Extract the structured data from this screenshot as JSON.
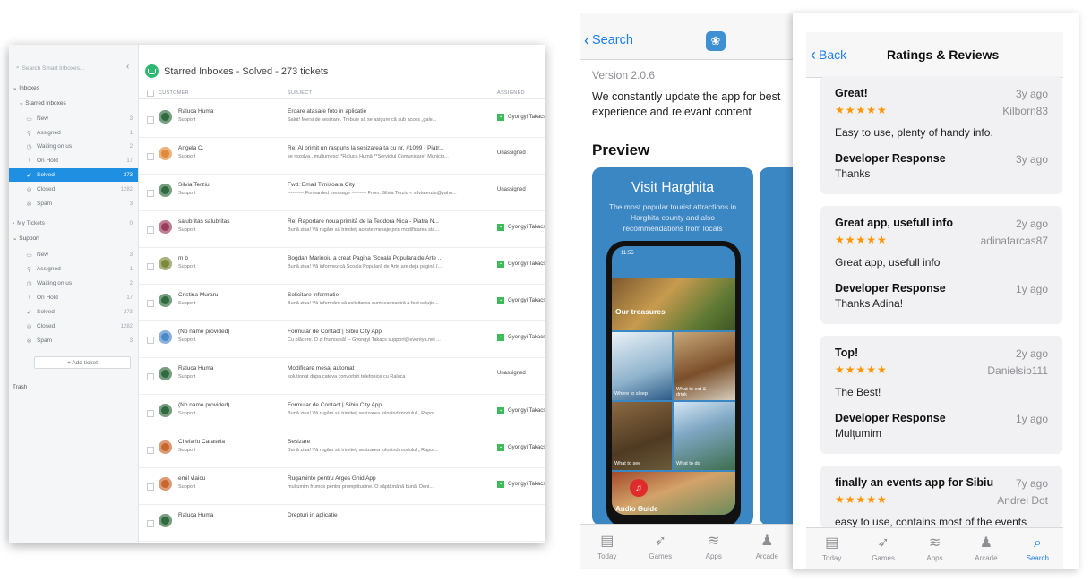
{
  "helpdesk": {
    "search_placeholder": "Search Smart Inboxes...",
    "title": "Starred Inboxes - Solved - 273 tickets",
    "sidebar": {
      "inboxes_label": "Inboxes",
      "starred_label": "Starred inboxes",
      "starred_items": [
        {
          "label": "New",
          "count": "3"
        },
        {
          "label": "Assigned",
          "count": "1"
        },
        {
          "label": "Waiting on us",
          "count": "2"
        },
        {
          "label": "On Hold",
          "count": "17"
        },
        {
          "label": "Solved",
          "count": "273"
        },
        {
          "label": "Closed",
          "count": "1282"
        },
        {
          "label": "Spam",
          "count": "3"
        }
      ],
      "my_tickets_label": "My Tickets",
      "my_tickets_count": "0",
      "support_label": "Support",
      "support_items": [
        {
          "label": "New",
          "count": "3"
        },
        {
          "label": "Assigned",
          "count": "1"
        },
        {
          "label": "Waiting on us",
          "count": "2"
        },
        {
          "label": "On Hold",
          "count": "17"
        },
        {
          "label": "Solved",
          "count": "273"
        },
        {
          "label": "Closed",
          "count": "1282"
        },
        {
          "label": "Spam",
          "count": "3"
        }
      ],
      "add_ticket_label": "+ Add ticket",
      "trash_label": "Trash"
    },
    "columns": {
      "customer": "CUSTOMER",
      "subject": "SUBJECT",
      "assigned": "ASSIGNED"
    },
    "tickets": [
      {
        "customer": "Raluca Huma",
        "inbox": "Support",
        "subject": "Eroare atasare foto in aplicatie",
        "preview": "Salut! Mersi de sesizare. Trebuie să se asigure că sub acces „gale...",
        "assigned": "Gyongyi Takacs",
        "avatar_color": "#2f6b3e"
      },
      {
        "customer": "Angela C.",
        "inbox": "Support",
        "subject": "Re: Al primit un raspuns la sesizarea ta cu nr. #1099 - Piatr...",
        "preview": "se rezolva.. multumesc! *Raluca Humă **Serviciul Comunicare* Municip...",
        "assigned": "Unassigned",
        "avatar_color": "#e08a3c"
      },
      {
        "customer": "Silvia Terziu",
        "inbox": "Support",
        "subject": "Fwd: Email Timisoara City",
        "preview": "---------- Forwarded message --------- From: Silvia Terziu < silviaterziu@yaho...",
        "assigned": "Unassigned",
        "avatar_color": "#2f6b3e"
      },
      {
        "customer": "salubritas salubritas",
        "inbox": "Support",
        "subject": "Re: Raportare noua primită de la Teodora Nica - Piatra N...",
        "preview": "Bună ziua! Vă rugăm să trimiteți aceste mesaje prin modificarea sta...",
        "assigned": "Gyongyi Takacs",
        "avatar_color": "#9a3b5a"
      },
      {
        "customer": "m b",
        "inbox": "Support",
        "subject": "Bogdan Marinoiu a creat Pagina 'Scoala Populara de Arte ...",
        "preview": "Bună ziua! Vă informez că Școala Populară de Arte are deja pagină î...",
        "assigned": "Gyongyi Takacs",
        "avatar_color": "#7a8a3a"
      },
      {
        "customer": "Cristina Muraru",
        "inbox": "Support",
        "subject": "Solicitare informatie",
        "preview": "Bună ziua! Vă informăm că solicitarea dumneavoastră a fost soluțio...",
        "assigned": "Gyongyi Takacs",
        "avatar_color": "#2f6b3e"
      },
      {
        "customer": "(No name provided)",
        "inbox": "Support",
        "subject": "Formular de Contact | Sibiu City App",
        "preview": "Cu plăcere. O zi frumoasă! -- Gyongyi Takacs support@eventya.net ...",
        "assigned": "Gyongyi Takacs",
        "avatar_color": "#4a88c8"
      },
      {
        "customer": "Raluca Huma",
        "inbox": "Support",
        "subject": "Modificare mesaj automat",
        "preview": "solutionat dupa cateva convorbiri telefonice cu Raluca",
        "assigned": "Unassigned",
        "avatar_color": "#2f6b3e"
      },
      {
        "customer": "(No name provided)",
        "inbox": "Support",
        "subject": "Formular de Contact | Sibiu City App",
        "preview": "Bună ziua! Vă rugăm să trimiteți sesizarea folosind modulul „ Rapor...",
        "assigned": "Gyongyi Takacs",
        "avatar_color": "#2f6b3e"
      },
      {
        "customer": "Chelariu Carasela",
        "inbox": "Support",
        "subject": "Sesizare",
        "preview": "Bună ziua! Vă rugăm să trimiteți sesizarea folosind modulul „ Rapor...",
        "assigned": "Gyongyi Takacs",
        "avatar_color": "#c8662e"
      },
      {
        "customer": "emil vlaicu",
        "inbox": "Support",
        "subject": "Rugaminte pentru Arges Ghid App",
        "preview": "mulțumim frumos pentru promptitudine. O săptămână bună, Deni...",
        "assigned": "Gyongyi Takacs",
        "avatar_color": "#c8662e"
      },
      {
        "customer": "Raluca Huma",
        "inbox": "",
        "subject": "Drepturi in aplicatie",
        "preview": "",
        "assigned": "",
        "avatar_color": "#2f6b3e"
      }
    ],
    "accent_color": "#1e8fe1",
    "assign_badge_color": "#3dbb5b"
  },
  "appstore_left": {
    "back_label": "Search",
    "version": "Version 2.0.6",
    "description": "We  constantly update the app for best experience and relevant content",
    "preview_heading": "Preview",
    "screenshot": {
      "title": "Visit Harghita",
      "subtitle": "The most popular tourist attractions in Harghita county and also recommendations from locals",
      "status_time": "11:55",
      "section_label": "Our treasures",
      "tiles": [
        "Where to sleep",
        "What to eat & drink",
        "What to see",
        "What to do",
        "Audio Guide"
      ]
    },
    "tabs": [
      "Today",
      "Games",
      "Apps",
      "Arcade"
    ]
  },
  "appstore_right": {
    "back_label": "Back",
    "title": "Ratings & Reviews",
    "reviews": [
      {
        "title": "Great!",
        "date": "3y ago",
        "stars": "★★★★★",
        "author": "Kilborn83",
        "body": "Easy to use, plenty of handy info.",
        "response_label": "Developer Response",
        "response_date": "3y ago",
        "response": "Thanks"
      },
      {
        "title": "Great app, usefull info",
        "date": "2y ago",
        "stars": "★★★★★",
        "author": "adinafarcas87",
        "body": "Great app, usefull info",
        "response_label": "Developer Response",
        "response_date": "1y ago",
        "response": "Thanks Adina!"
      },
      {
        "title": "Top!",
        "date": "2y ago",
        "stars": "★★★★★",
        "author": "Danielsib111",
        "body": "The Best!",
        "response_label": "Developer Response",
        "response_date": "1y ago",
        "response": "Mulțumim"
      },
      {
        "title": "finally an events app for Sibiu",
        "date": "7y ago",
        "stars": "★★★★★",
        "author": "Andrei Dot",
        "body": "easy to use, contains most of the events",
        "response_label": "",
        "response_date": "",
        "response": ""
      }
    ],
    "tabs": [
      "Today",
      "Games",
      "Apps",
      "Arcade",
      "Search"
    ],
    "active_tab": "Search",
    "star_color": "#ff9500",
    "link_color": "#1a7df2"
  }
}
